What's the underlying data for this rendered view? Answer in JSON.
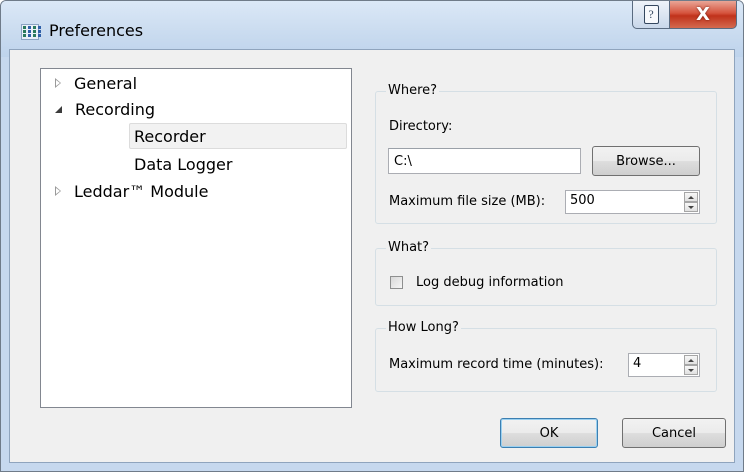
{
  "window": {
    "title": "Preferences",
    "help_glyph": "?",
    "close_glyph": "X"
  },
  "tree": {
    "items": [
      {
        "label": "General",
        "state": "collapsed"
      },
      {
        "label": "Recording",
        "state": "expanded"
      },
      {
        "label": "Recorder",
        "state": "selected"
      },
      {
        "label": "Data Logger",
        "state": "leaf"
      },
      {
        "label": "Leddar™ Module",
        "state": "collapsed"
      }
    ]
  },
  "where": {
    "title": "Where?",
    "directory_label": "Directory:",
    "directory_value": "C:\\",
    "browse_label": "Browse...",
    "max_size_label": "Maximum file size (MB):",
    "max_size_value": "500"
  },
  "what": {
    "title": "What?",
    "log_debug_label": "Log debug information",
    "log_debug_checked": false
  },
  "how_long": {
    "title": "How Long?",
    "max_time_label": "Maximum record time (minutes):",
    "max_time_value": "4"
  },
  "buttons": {
    "ok_label": "OK",
    "cancel_label": "Cancel"
  },
  "colors": {
    "title_bar": "#c9dbef",
    "close_button": "#c7432b",
    "dialog_background": "#f0f0f0",
    "default_button_border": "#3c7fb1"
  },
  "icons": {
    "app": "grid-app-icon",
    "help": "help-icon",
    "close": "close-icon",
    "tree_collapsed": "triangle-right-icon",
    "tree_expanded": "triangle-down-icon",
    "spin_up": "spin-up-icon",
    "spin_down": "spin-down-icon"
  }
}
